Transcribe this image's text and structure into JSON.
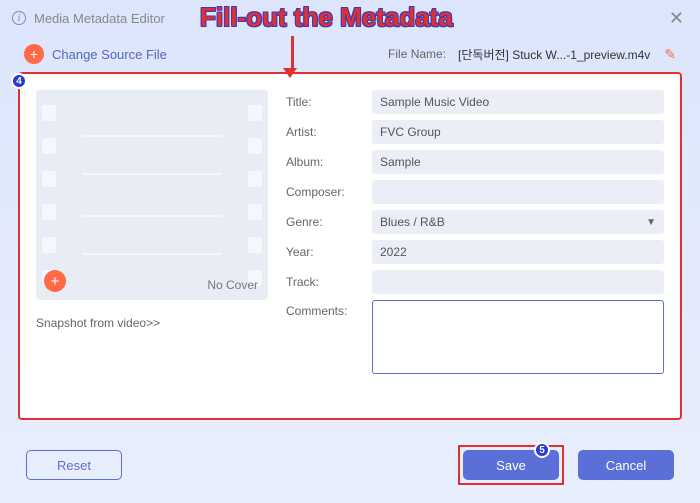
{
  "window": {
    "title": "Media Metadata Editor"
  },
  "annotation": {
    "text": "Fill-out the Metadata"
  },
  "toolbar": {
    "change_source": "Change Source File",
    "filename_label": "File Name:",
    "filename_value": "[단독버전] Stuck W...-1_preview.m4v"
  },
  "cover": {
    "no_cover": "No Cover",
    "snapshot": "Snapshot from video>>"
  },
  "form": {
    "title": {
      "label": "Title:",
      "value": "Sample Music Video"
    },
    "artist": {
      "label": "Artist:",
      "value": "FVC Group"
    },
    "album": {
      "label": "Album:",
      "value": "Sample"
    },
    "composer": {
      "label": "Composer:",
      "value": ""
    },
    "genre": {
      "label": "Genre:",
      "value": "Blues / R&B"
    },
    "year": {
      "label": "Year:",
      "value": "2022"
    },
    "track": {
      "label": "Track:",
      "value": ""
    },
    "comments": {
      "label": "Comments:",
      "value": ""
    }
  },
  "footer": {
    "reset": "Reset",
    "save": "Save",
    "cancel": "Cancel"
  },
  "badges": {
    "step4": "4",
    "step5": "5"
  }
}
